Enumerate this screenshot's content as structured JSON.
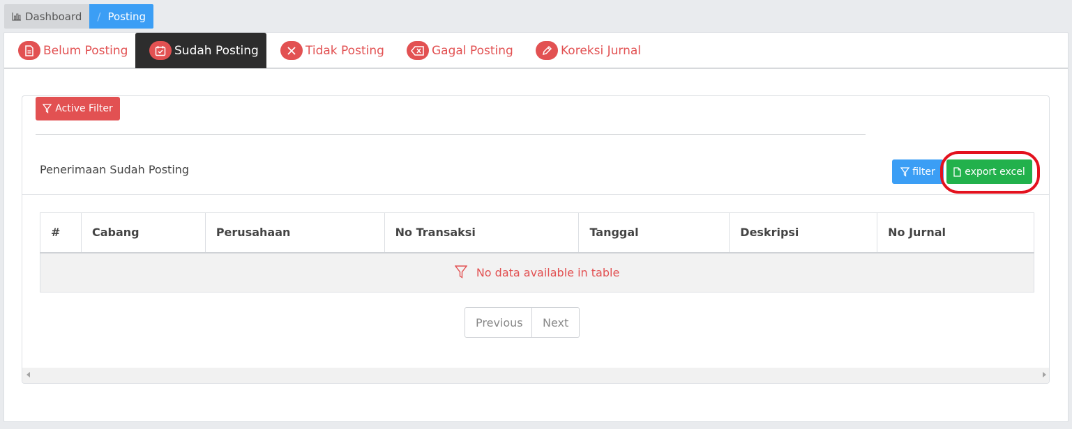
{
  "breadcrumb": {
    "home": "Dashboard",
    "separator": "/",
    "current": "Posting"
  },
  "tabs": [
    {
      "label": "Belum Posting",
      "icon": "document-icon"
    },
    {
      "label": "Sudah Posting",
      "icon": "calendar-check-icon",
      "active": true
    },
    {
      "label": "Tidak Posting",
      "icon": "x-circle-icon"
    },
    {
      "label": "Gagal Posting",
      "icon": "backspace-icon"
    },
    {
      "label": "Koreksi Jurnal",
      "icon": "pen-icon"
    }
  ],
  "filter_bar": {
    "active_filter_label": "Active Filter"
  },
  "section": {
    "title": "Penerimaan Sudah Posting",
    "filter_label": "filter",
    "export_label": "export excel"
  },
  "table": {
    "columns": [
      "#",
      "Cabang",
      "Perusahaan",
      "No Transaksi",
      "Tanggal",
      "Deskripsi",
      "No Jurnal"
    ],
    "empty_message": "No data available in table"
  },
  "pagination": {
    "previous": "Previous",
    "next": "Next"
  },
  "colors": {
    "danger": "#e25152",
    "primary": "#3b9ef5",
    "success": "#22b14c",
    "highlight": "#e3121e",
    "active_tab": "#2d2d2d"
  }
}
